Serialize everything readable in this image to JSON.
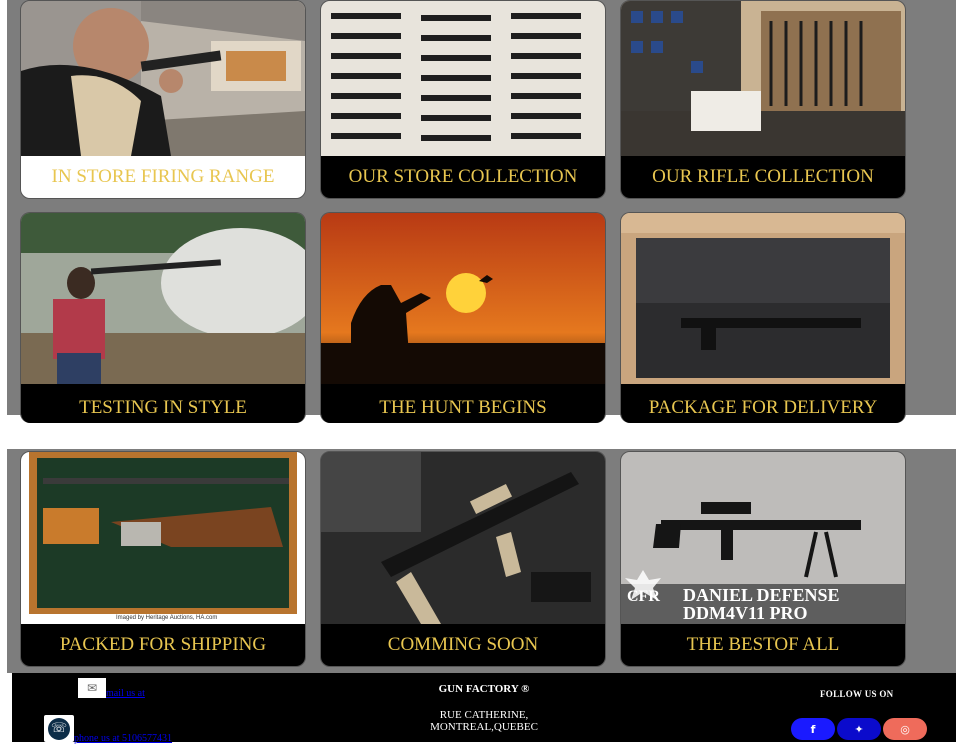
{
  "gallery_top": [
    {
      "caption": "IN STORE FIRING RANGE",
      "image": "shooter at indoor firing range"
    },
    {
      "caption": "OUR STORE COLLECTION",
      "image": "wall rack of rifles"
    },
    {
      "caption": "OUR RIFLE COLLECTION",
      "image": "gun store interior"
    },
    {
      "caption": "TESTING IN STYLE",
      "image": "woman shooting rifle outdoors"
    },
    {
      "caption": "THE HUNT BEGINS",
      "image": "hunter silhouette at sunset"
    },
    {
      "caption": "PACKAGE FOR DELIVERY",
      "image": "rifle in foam case"
    }
  ],
  "gallery_bottom": [
    {
      "caption": "PACKED FOR SHIPPING",
      "image": "shotgun in wooden case",
      "image_text": "Imaged by Heritage Auctions, HA.com"
    },
    {
      "caption": "COMMING SOON",
      "image": "tactical rifle with accessories"
    },
    {
      "caption": "THE BESTOF ALL",
      "image": "DDM4V11 PRO rifle on bipod",
      "image_text": "DANIEL DEFENSE DDM4V11 PRO",
      "logo_text": "CFR"
    }
  ],
  "footer": {
    "mail_link": "mail us at",
    "phone_link": "phone us at 5106577431",
    "brand": "GUN FACTORY ®",
    "address_line1": "RUE CATHERINE,",
    "address_line2": "MONTREAL,QUEBEC",
    "follow_label": "FOLLOW US ON",
    "social": [
      {
        "name": "facebook",
        "glyph": "f",
        "color": "#1a1aff"
      },
      {
        "name": "twitter",
        "glyph": "🐦",
        "color": "#0b0bcc"
      },
      {
        "name": "instagram",
        "glyph": "◎",
        "color": "#ef6b5b"
      }
    ]
  },
  "colors": {
    "caption_gold": "#e8c650",
    "band_gray": "#7d7d7d",
    "footer_black": "#000000"
  }
}
